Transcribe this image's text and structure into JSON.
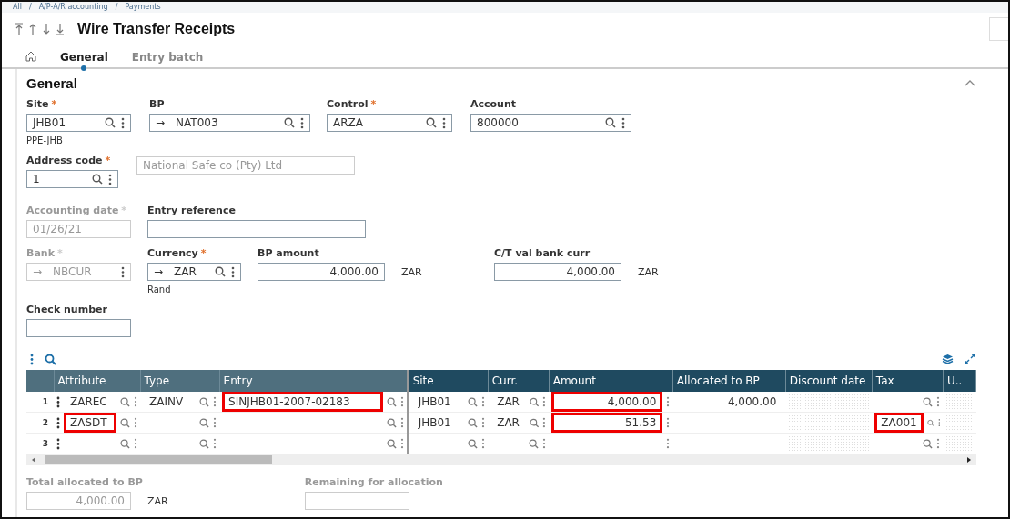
{
  "breadcrumb": [
    "All",
    "/",
    "A/P-A/R accounting",
    "/",
    "Payments"
  ],
  "title": "Wire Transfer Receipts",
  "tabs": [
    {
      "label": "General",
      "selected": true
    },
    {
      "label": "Entry batch",
      "selected": false
    }
  ],
  "section": {
    "title": "General",
    "expanded": true
  },
  "field_rows": [
    [
      {
        "label": "Site",
        "marker": "*",
        "value": "JHB01",
        "lookup": true,
        "menu": true,
        "disabled": false,
        "note": "PPE-JHB"
      },
      {
        "label": "BP",
        "prefix": "→",
        "value": "NAT003",
        "lookup": true,
        "menu": true,
        "disabled": false
      },
      {
        "label": "Control",
        "marker": "*",
        "value": "ARZA",
        "lookup": true,
        "menu": true,
        "disabled": false
      },
      {
        "label": "Account",
        "value": "800000",
        "lookup": true,
        "menu": true,
        "disabled": false
      }
    ],
    [
      {
        "label": "Address code",
        "marker": "*",
        "value": "1",
        "lookup": true,
        "menu": true,
        "disabled": false
      },
      {
        "value": "National Safe co (Pty) Ltd",
        "lookup": false,
        "menu": false,
        "disabled": true
      }
    ],
    [
      {
        "label": "Accounting date",
        "marker": "*",
        "value": "01/26/21",
        "lookup": false,
        "menu": false,
        "disabled": true
      },
      {
        "label": "Entry reference",
        "lookup": false,
        "menu": false,
        "disabled": false
      }
    ],
    [
      {
        "label": "Bank",
        "marker": "*",
        "prefix": "→",
        "value": "NBCUR",
        "lookup": false,
        "menu": true,
        "disabled": true
      },
      {
        "label": "Currency",
        "marker": "*",
        "prefix": "→",
        "value": "ZAR",
        "lookup": true,
        "menu": true,
        "disabled": false,
        "note": "Rand"
      },
      {
        "label": "BP amount",
        "value": "4,000.00",
        "numeric": true,
        "lookup": false,
        "menu": false,
        "disabled": false,
        "unit": "ZAR"
      },
      {
        "label": "C/T val bank curr",
        "value": "4,000.00",
        "numeric": true,
        "lookup": false,
        "menu": false,
        "disabled": false,
        "unit": "ZAR"
      }
    ],
    [
      {
        "label": "Check number",
        "lookup": false,
        "menu": false,
        "disabled": false
      }
    ]
  ],
  "grid": {
    "columns": [
      {
        "label": "Attribute",
        "kind": "lookup",
        "frozen": true
      },
      {
        "label": "Type",
        "kind": "lookup",
        "frozen": true
      },
      {
        "label": "Entry",
        "kind": "lookup",
        "frozen": true
      },
      {
        "label": "Site",
        "kind": "lookup",
        "frozen": false
      },
      {
        "label": "Curr.",
        "kind": "lookup",
        "frozen": false
      },
      {
        "label": "Amount",
        "kind": "numeric",
        "frozen": false
      },
      {
        "label": "Allocated to BP",
        "kind": "readonly",
        "frozen": false
      },
      {
        "label": "Discount date",
        "kind": "disabled",
        "frozen": false
      },
      {
        "label": "Tax",
        "kind": "lookup",
        "frozen": false
      },
      {
        "label": "U..",
        "kind": "disabled",
        "frozen": false
      }
    ],
    "rows": [
      {
        "number": "1",
        "cells": [
          {
            "value": "ZAREC"
          },
          {
            "value": "ZAINV"
          },
          {
            "value": "SINJHB01-2007-02183",
            "highlighted": true
          },
          {
            "value": "JHB01"
          },
          {
            "value": "ZAR"
          },
          {
            "value": "4,000.00",
            "highlighted": true
          },
          {
            "value": "4,000.00"
          },
          {},
          {},
          {}
        ]
      },
      {
        "number": "2",
        "cells": [
          {
            "value": "ZASDT",
            "highlighted": true
          },
          {},
          {},
          {
            "value": "JHB01"
          },
          {
            "value": "ZAR"
          },
          {
            "value": "51.53",
            "highlighted": true
          },
          {},
          {},
          {
            "value": "ZA001",
            "highlighted": true
          },
          {}
        ]
      },
      {
        "number": "3",
        "cells": [
          {},
          {},
          {},
          {},
          {},
          {},
          {},
          {},
          {},
          {}
        ]
      }
    ]
  },
  "totals": [
    {
      "label": "Total allocated to BP",
      "value": "4,000.00",
      "unit": "ZAR"
    },
    {
      "label": "Remaining for allocation"
    }
  ]
}
